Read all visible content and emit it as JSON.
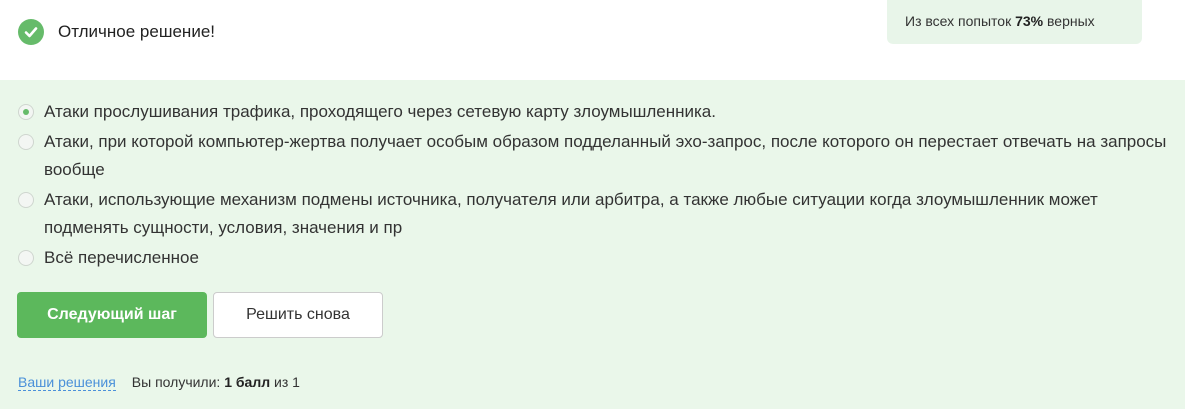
{
  "feedback": {
    "icon": "check-circle-icon",
    "text": "Отличное решение!",
    "accent": "#66bb6a"
  },
  "stats": {
    "prefix": "Из всех попыток",
    "percent": "73%",
    "suffix": "верных"
  },
  "options": [
    {
      "label": "Атаки прослушивания трафика, проходящего через сетевую карту злоумышленника.",
      "selected": true
    },
    {
      "label": "Атаки, при которой компьютер-жертва получает особым образом подделанный эхо-запрос, после которого он перестает отвечать на запросы вообще",
      "selected": false
    },
    {
      "label": "Атаки, использующие механизм подмены источника, получателя или арбитра, а также любые ситуации когда злоумышленник может подменять сущности, условия, значения и пр",
      "selected": false
    },
    {
      "label": "Всё перечисленное",
      "selected": false
    }
  ],
  "buttons": {
    "next_label": "Следующий шаг",
    "retry_label": "Решить снова"
  },
  "footer": {
    "solutions_link": "Ваши решения",
    "score_prefix": "Вы получили:",
    "score_value": "1 балл",
    "score_suffix": "из 1"
  },
  "colors": {
    "panel_bg": "#eaf7ea",
    "primary_button": "#5cb85c",
    "link": "#4a90d9"
  }
}
